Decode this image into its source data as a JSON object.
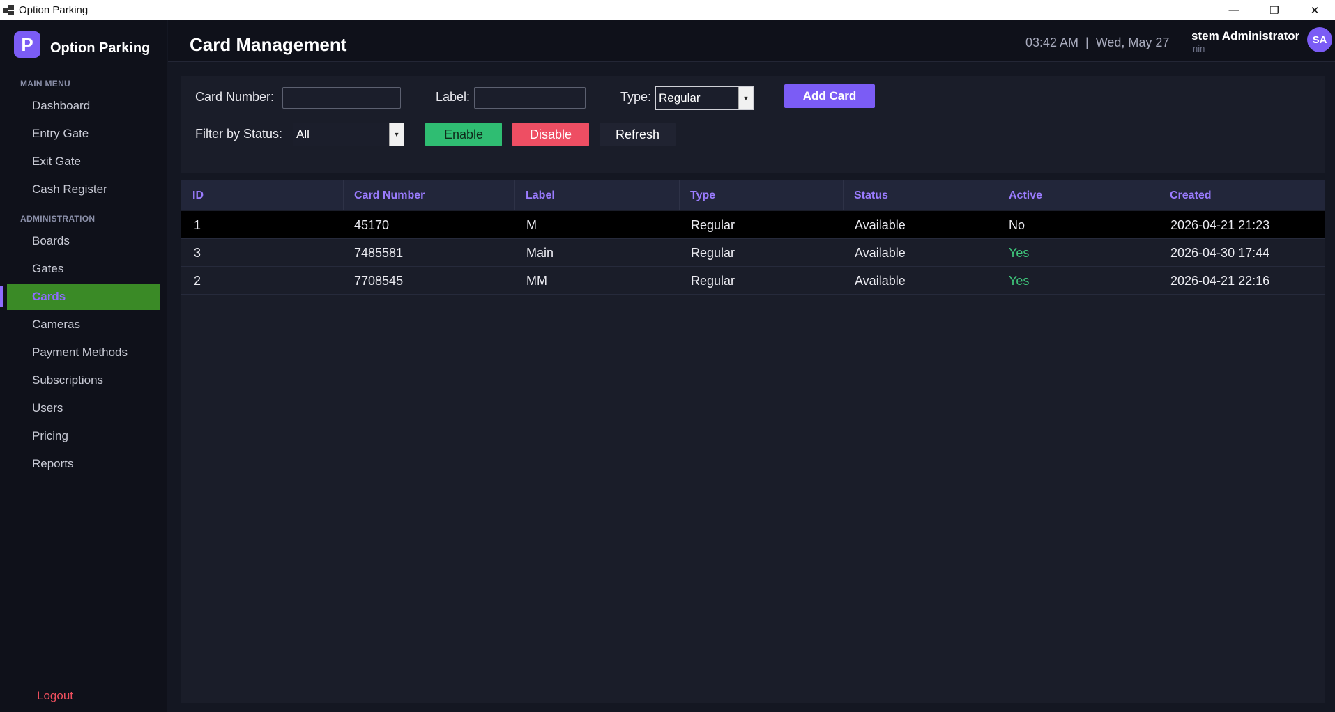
{
  "window": {
    "title": "Option Parking",
    "controls": {
      "minimize": "—",
      "restore": "❐",
      "close": "✕"
    }
  },
  "sidebar": {
    "brand_logo": "P",
    "brand_name": "Option Parking",
    "main_menu_label": "MAIN MENU",
    "main_items": [
      {
        "label": "Dashboard"
      },
      {
        "label": "Entry Gate"
      },
      {
        "label": "Exit Gate"
      },
      {
        "label": "Cash Register"
      }
    ],
    "admin_label": "ADMINISTRATION",
    "admin_items": [
      {
        "label": "Boards"
      },
      {
        "label": "Gates"
      },
      {
        "label": "Cards",
        "active": true
      },
      {
        "label": "Cameras"
      },
      {
        "label": "Payment Methods"
      },
      {
        "label": "Subscriptions"
      },
      {
        "label": "Users"
      },
      {
        "label": "Pricing"
      },
      {
        "label": "Reports"
      }
    ],
    "logout_label": "Logout"
  },
  "header": {
    "title": "Card Management",
    "clock": "03:42 AM  |  Wed, May 27",
    "user_name": "stem Administrator",
    "user_role": "nin",
    "avatar_initials": "SA"
  },
  "form": {
    "card_number_label": "Card Number:",
    "card_number_value": "",
    "label_label": "Label:",
    "label_value": "",
    "type_label": "Type:",
    "type_selected": "Regular",
    "add_card_button": "Add Card",
    "filter_label": "Filter by Status:",
    "filter_selected": "All",
    "enable_button": "Enable",
    "disable_button": "Disable",
    "refresh_button": "Refresh"
  },
  "table": {
    "columns": [
      "ID",
      "Card Number",
      "Label",
      "Type",
      "Status",
      "Active",
      "Created"
    ],
    "rows": [
      {
        "id": "1",
        "card_number": "45170",
        "label": "M",
        "type": "Regular",
        "status": "Available",
        "active": "No",
        "created": "2026-04-21 21:23",
        "selected": true
      },
      {
        "id": "3",
        "card_number": "7485581",
        "label": "Main",
        "type": "Regular",
        "status": "Available",
        "active": "Yes",
        "created": "2026-04-30 17:44"
      },
      {
        "id": "2",
        "card_number": "7708545",
        "label": "MM",
        "type": "Regular",
        "status": "Available",
        "active": "Yes",
        "created": "2026-04-21 22:16"
      }
    ]
  },
  "colors": {
    "accent": "#7b5cf5",
    "active_nav_bg": "#3a8a26",
    "enable": "#2fbd72",
    "disable": "#ee4e63",
    "yes_text": "#3fc77b",
    "logout": "#ef4f5e"
  }
}
